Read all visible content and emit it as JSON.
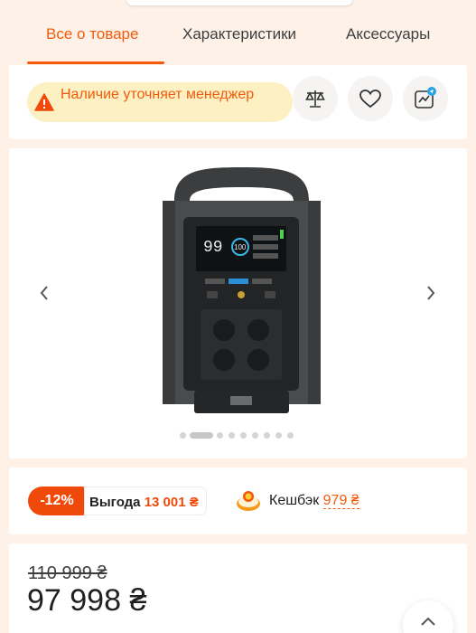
{
  "tabs": [
    {
      "label": "Все о товаре",
      "active": true
    },
    {
      "label": "Характеристики",
      "active": false
    },
    {
      "label": "Аксессуары",
      "active": false
    }
  ],
  "availability": {
    "text": "Наличие уточняет менеджер",
    "icon": "warning-icon"
  },
  "actions": {
    "compare_icon": "scales-icon",
    "wishlist_icon": "heart-icon",
    "share_icon": "telegram-share-icon"
  },
  "product_image": {
    "display_battery": "99",
    "display_percent": "100",
    "slide_count": 9,
    "active_slide": 1
  },
  "benefit": {
    "discount": "-12%",
    "label": "Выгода",
    "value": "13 001 ₴"
  },
  "cashback": {
    "label": "Кешбэк",
    "value": "979 ₴"
  },
  "price": {
    "old": "110 999 ₴",
    "current": "97 998 ₴"
  },
  "colors": {
    "accent": "#f45a0b",
    "warning_bg": "#fdf0c2"
  }
}
